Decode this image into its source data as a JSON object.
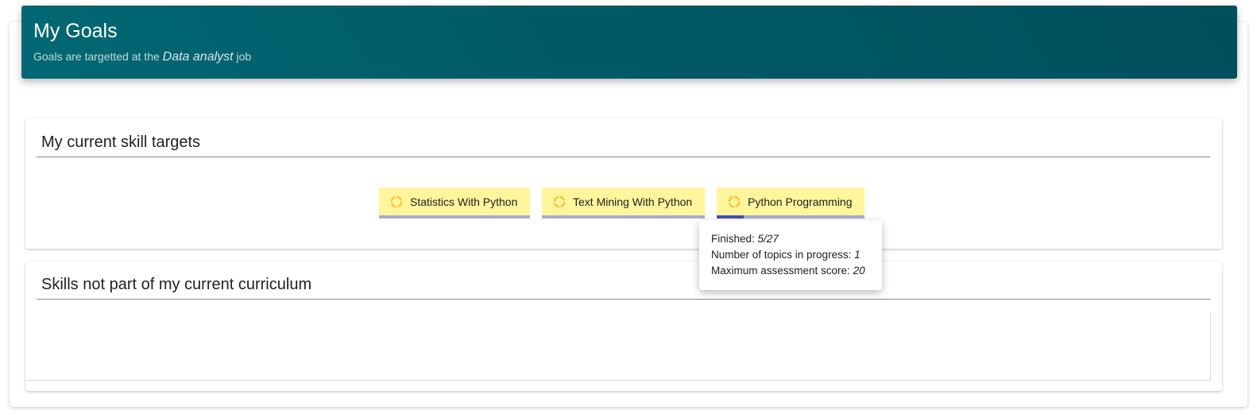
{
  "header": {
    "title": "My Goals",
    "subtitle_prefix": "Goals are targetted at the",
    "job_name": "Data analyst",
    "subtitle_suffix": "job"
  },
  "current_targets": {
    "title": "My current skill targets",
    "skills": [
      {
        "label": "Statistics With Python",
        "icon": "in-progress-circle-icon",
        "progress": 0
      },
      {
        "label": "Text Mining With Python",
        "icon": "in-progress-circle-icon",
        "progress": 0
      },
      {
        "label": "Python Programming",
        "icon": "in-progress-circle-icon",
        "progress": 0.185
      }
    ]
  },
  "tooltip": {
    "finished_label": "Finished:",
    "finished_value": "5/27",
    "in_progress_label": "Number of topics in progress:",
    "in_progress_value": "1",
    "max_score_label": "Maximum assessment score:",
    "max_score_value": "20"
  },
  "other_skills": {
    "title": "Skills not part of my current curriculum"
  },
  "colors": {
    "header_gradient_start": "#006874",
    "header_gradient_end": "#004f5c",
    "chip_background": "#fff59d",
    "chip_icon": "#fbc02d",
    "progress_track": "#a9acd4",
    "progress_fill": "#3f51b5"
  }
}
